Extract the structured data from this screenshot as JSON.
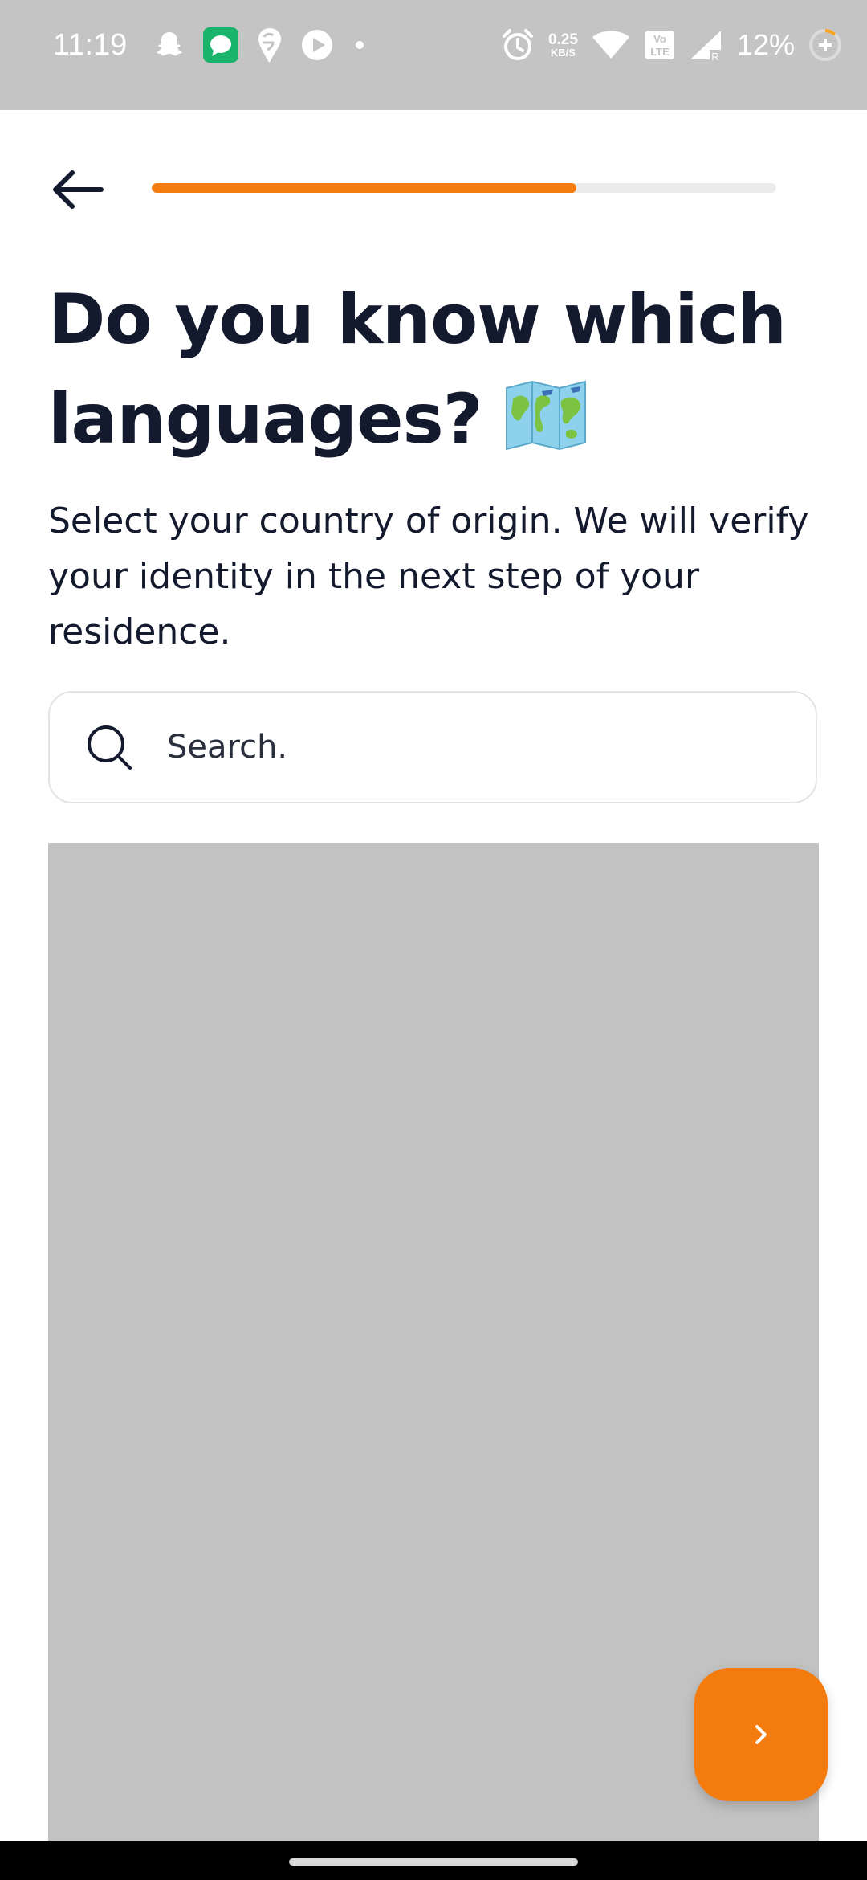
{
  "status_bar": {
    "time": "11:19",
    "net_speed_value": "0.25",
    "net_speed_unit": "KB/S",
    "network_label": "VoLTE",
    "battery": "12%",
    "icons": [
      "snapchat-icon",
      "messages-icon",
      "swiggy-icon",
      "play-icon",
      "dot-icon",
      "alarm-icon",
      "wifi-icon",
      "volte-icon",
      "signal-icon",
      "battery-saver-icon"
    ]
  },
  "header": {
    "back_icon": "arrow-left-icon",
    "progress": 0.68,
    "progress_color": "#f47b0e"
  },
  "main": {
    "title": "Do you know which languages?",
    "title_emoji": "world-map-icon",
    "subtitle": "Select your country of origin. We will verify your identity in the next step of your residence."
  },
  "search": {
    "placeholder": "Search.",
    "value": "",
    "icon": "search-icon"
  },
  "next_button": {
    "icon": "chevron-right-icon",
    "color": "#f47b0e"
  },
  "colors": {
    "accent": "#f47b0e",
    "text": "#141a2e"
  }
}
